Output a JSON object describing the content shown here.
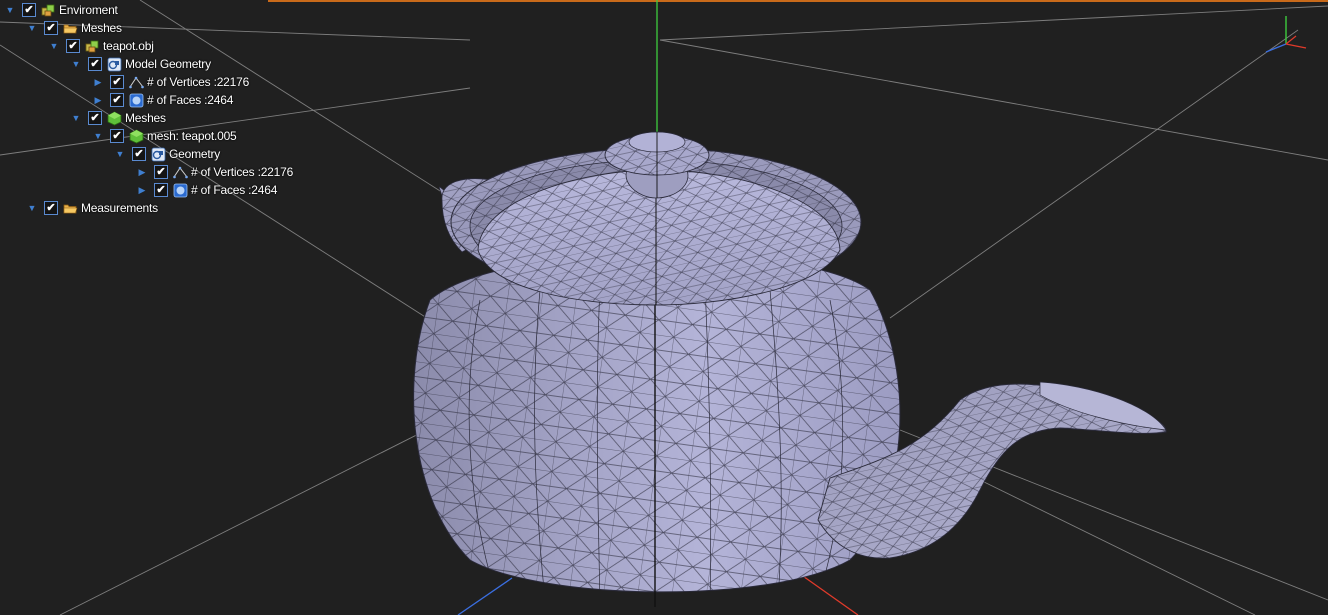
{
  "tree": [
    {
      "id": "environment",
      "label": "Enviroment",
      "icon": "environment-icon",
      "expanded": true,
      "checked": true,
      "depth": 0
    },
    {
      "id": "meshes-folder",
      "label": "Meshes",
      "icon": "folder-icon",
      "expanded": true,
      "checked": true,
      "depth": 1
    },
    {
      "id": "teapot-obj",
      "label": "teapot.obj",
      "icon": "model-object-icon",
      "expanded": true,
      "checked": true,
      "depth": 2
    },
    {
      "id": "model-geometry",
      "label": "Model Geometry",
      "icon": "geometry-icon",
      "expanded": true,
      "checked": true,
      "depth": 3
    },
    {
      "id": "model-vertices",
      "label": "# of Vertices :22176",
      "icon": "vertices-icon",
      "expanded": false,
      "checked": true,
      "depth": 4
    },
    {
      "id": "model-faces",
      "label": "# of Faces :2464",
      "icon": "faces-icon",
      "expanded": false,
      "checked": true,
      "depth": 4
    },
    {
      "id": "meshes-group",
      "label": "Meshes",
      "icon": "mesh-group-icon",
      "expanded": true,
      "checked": true,
      "depth": 3
    },
    {
      "id": "mesh-teapot",
      "label": "mesh: teapot.005",
      "icon": "mesh-icon",
      "expanded": true,
      "checked": true,
      "depth": 4
    },
    {
      "id": "mesh-geometry",
      "label": "Geometry",
      "icon": "geometry-icon",
      "expanded": true,
      "checked": true,
      "depth": 5
    },
    {
      "id": "mesh-vertices",
      "label": "# of Vertices :22176",
      "icon": "vertices-icon",
      "expanded": false,
      "checked": true,
      "depth": 6
    },
    {
      "id": "mesh-faces",
      "label": "# of Faces :2464",
      "icon": "faces-icon",
      "expanded": false,
      "checked": true,
      "depth": 6
    },
    {
      "id": "measurements",
      "label": "Measurements",
      "icon": "folder-icon",
      "expanded": true,
      "checked": true,
      "depth": 1
    }
  ],
  "colors": {
    "background": "#202020",
    "grid": "#8a8a8a",
    "mesh_fill": "#a9a9cf",
    "mesh_wire": "#2a2a3a",
    "axis_x": "#e03a2a",
    "axis_y": "#3ecc3e",
    "axis_z": "#3a6ee0",
    "accent": "#c96a1a"
  },
  "icons": {
    "expanded": "▼",
    "collapsed": "▶",
    "check": "✔"
  }
}
